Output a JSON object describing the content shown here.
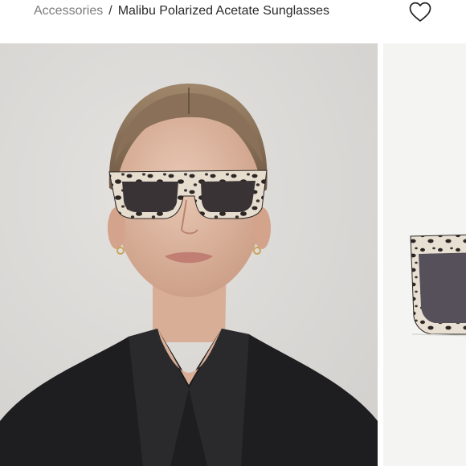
{
  "breadcrumb": {
    "parent": "Accessories",
    "separator": "/",
    "current": "Malibu Polarized Acetate Sunglasses"
  },
  "icons": {
    "favorite": "heart-outline-icon"
  },
  "colors": {
    "breadcrumb_link": "#7c7c7c",
    "breadcrumb_current": "#2a2a2a",
    "photo_background": "#dedcd9",
    "tortoise_frame": "#e6ddcf",
    "lens": "#3a3336"
  }
}
